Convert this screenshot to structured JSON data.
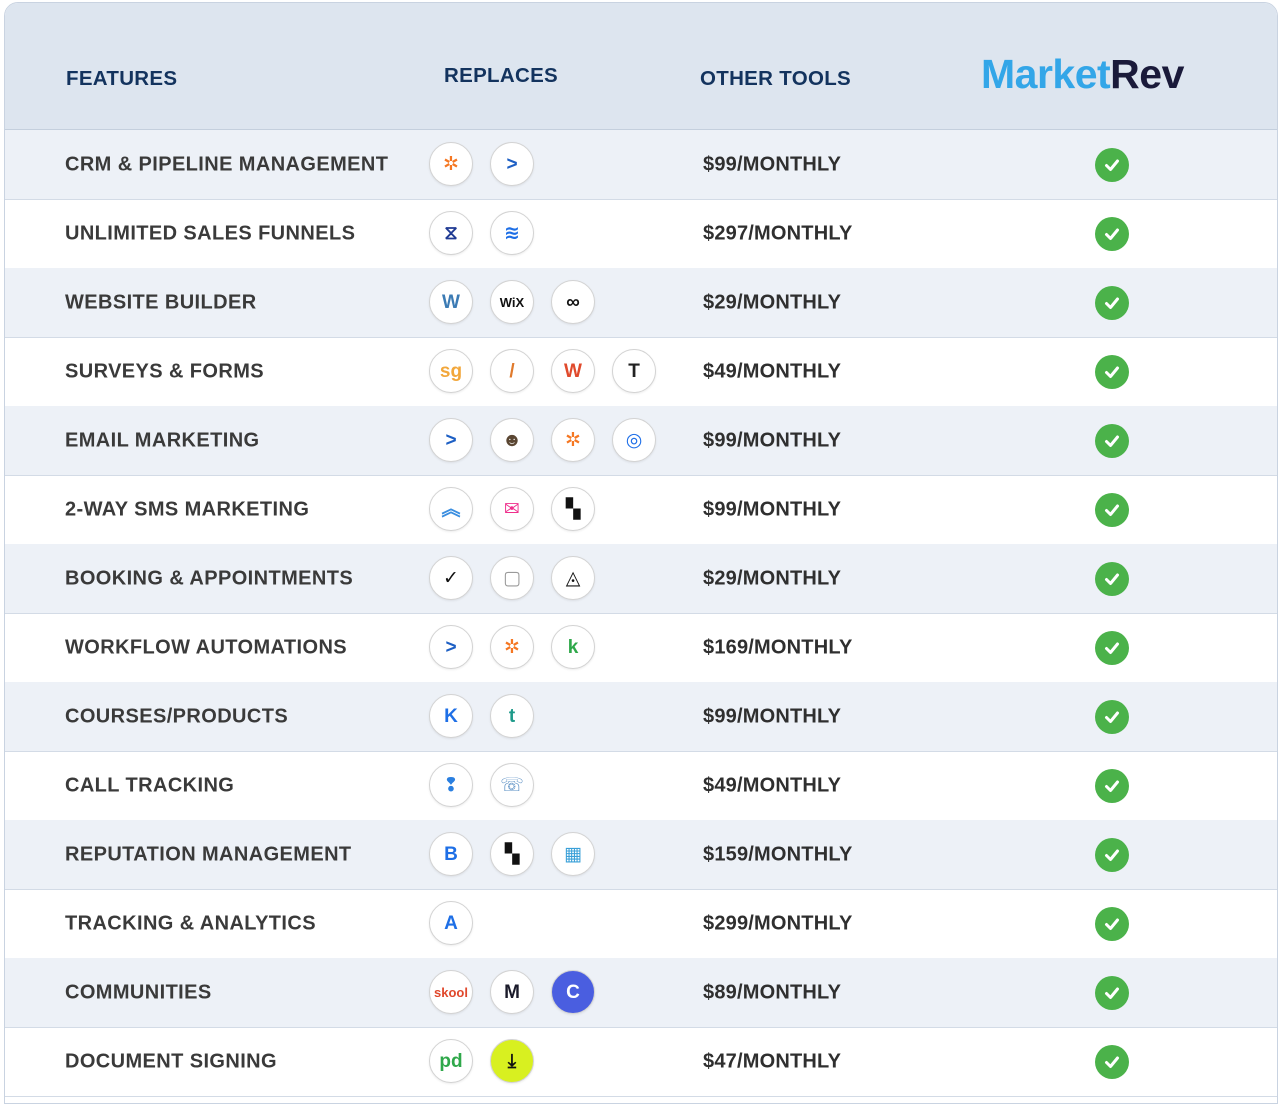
{
  "header": {
    "features": "FEATURES",
    "replaces": "REPLACES",
    "other_tools": "OTHER TOOLS",
    "logo_part1": "Market",
    "logo_part2": "Rev"
  },
  "colors": {
    "header_bg": "#dde5ef",
    "header_text": "#13335e",
    "logo_blue": "#33a6e8",
    "logo_dark": "#1a1a3a",
    "check_green": "#4bb24a",
    "alt_row": "#edf1f7"
  },
  "rows": [
    {
      "feature": "CRM & PIPELINE MANAGEMENT",
      "price": "$99/MONTHLY",
      "included": true,
      "icons": [
        {
          "name": "hubspot-icon",
          "glyph": "✲",
          "color": "#f57722"
        },
        {
          "name": "activecampaign-icon",
          "glyph": ">",
          "color": "#1d5fc4"
        }
      ]
    },
    {
      "feature": "UNLIMITED SALES FUNNELS",
      "price": "$297/MONTHLY",
      "included": true,
      "icons": [
        {
          "name": "clickfunnels-icon",
          "glyph": "⧖",
          "color": "#1f3a93"
        },
        {
          "name": "leadpages-icon",
          "glyph": "≋",
          "color": "#1e6fe6"
        }
      ]
    },
    {
      "feature": "WEBSITE BUILDER",
      "price": "$29/MONTHLY",
      "included": true,
      "icons": [
        {
          "name": "wordpress-icon",
          "glyph": "W",
          "color": "#3c7bb4"
        },
        {
          "name": "wix-icon",
          "glyph": "WiX",
          "color": "#111111"
        },
        {
          "name": "squarespace-icon",
          "glyph": "∞",
          "color": "#111111"
        }
      ]
    },
    {
      "feature": "SURVEYS & FORMS",
      "price": "$49/MONTHLY",
      "included": true,
      "icons": [
        {
          "name": "surveygizmo-icon",
          "glyph": "sg",
          "color": "#f2a73b"
        },
        {
          "name": "formstack-icon",
          "glyph": "/",
          "color": "#e07a2c"
        },
        {
          "name": "wufoo-icon",
          "glyph": "W",
          "color": "#e04a2c"
        },
        {
          "name": "typeform-icon",
          "glyph": "T",
          "color": "#222222"
        }
      ]
    },
    {
      "feature": "EMAIL MARKETING",
      "price": "$99/MONTHLY",
      "included": true,
      "icons": [
        {
          "name": "activecampaign-icon",
          "glyph": ">",
          "color": "#1d5fc4"
        },
        {
          "name": "mailchimp-icon",
          "glyph": "☻",
          "color": "#5a4632"
        },
        {
          "name": "hubspot-icon",
          "glyph": "✲",
          "color": "#f57722"
        },
        {
          "name": "constant-contact-icon",
          "glyph": "◎",
          "color": "#1d6ee8"
        }
      ]
    },
    {
      "feature": "2-WAY SMS MARKETING",
      "price": "$99/MONTHLY",
      "included": true,
      "icons": [
        {
          "name": "simpletexting-icon",
          "glyph": "︽",
          "color": "#3a8ee0"
        },
        {
          "name": "eztexting-icon",
          "glyph": "✉",
          "color": "#ef2f8c"
        },
        {
          "name": "podium-icon",
          "glyph": "▚",
          "color": "#111111"
        }
      ]
    },
    {
      "feature": "BOOKING & APPOINTMENTS",
      "price": "$29/MONTHLY",
      "included": true,
      "icons": [
        {
          "name": "calendly-icon",
          "glyph": "✓",
          "color": "#111111"
        },
        {
          "name": "calendar-icon",
          "glyph": "▢",
          "color": "#9a9a9a"
        },
        {
          "name": "acuity-icon",
          "glyph": "◬",
          "color": "#111111"
        }
      ]
    },
    {
      "feature": "WORKFLOW AUTOMATIONS",
      "price": "$169/MONTHLY",
      "included": true,
      "icons": [
        {
          "name": "activecampaign-icon",
          "glyph": ">",
          "color": "#1d5fc4"
        },
        {
          "name": "hubspot-icon",
          "glyph": "✲",
          "color": "#f57722"
        },
        {
          "name": "keap-icon",
          "glyph": "k",
          "color": "#2fa84a"
        }
      ]
    },
    {
      "feature": "COURSES/PRODUCTS",
      "price": "$99/MONTHLY",
      "included": true,
      "icons": [
        {
          "name": "kajabi-icon",
          "glyph": "K",
          "color": "#1e6fe6"
        },
        {
          "name": "teachable-icon",
          "glyph": "t",
          "color": "#1e9a8a"
        }
      ]
    },
    {
      "feature": "CALL TRACKING",
      "price": "$49/MONTHLY",
      "included": true,
      "icons": [
        {
          "name": "callrail-icon",
          "glyph": "❢",
          "color": "#2a7fe0"
        },
        {
          "name": "callrail-alt-icon",
          "glyph": "☏",
          "color": "#5a8fc4"
        }
      ]
    },
    {
      "feature": "REPUTATION MANAGEMENT",
      "price": "$159/MONTHLY",
      "included": true,
      "icons": [
        {
          "name": "birdeye-icon",
          "glyph": "B",
          "color": "#1e6fe6"
        },
        {
          "name": "podium-icon",
          "glyph": "▚",
          "color": "#111111"
        },
        {
          "name": "grade-us-icon",
          "glyph": "▦",
          "color": "#3aa0d8"
        }
      ]
    },
    {
      "feature": "TRACKING & ANALYTICS",
      "price": "$299/MONTHLY",
      "included": true,
      "icons": [
        {
          "name": "analytics-icon",
          "glyph": "A",
          "color": "#1e6fe6"
        }
      ]
    },
    {
      "feature": "COMMUNITIES",
      "price": "$89/MONTHLY",
      "included": true,
      "icons": [
        {
          "name": "skool-icon",
          "glyph": "skool",
          "color": "#e0482c"
        },
        {
          "name": "mighty-networks-icon",
          "glyph": "M",
          "color": "#1a1a2a"
        },
        {
          "name": "circle-icon",
          "glyph": "C",
          "color": "#ffffff",
          "bg": "#4a5ee0"
        }
      ]
    },
    {
      "feature": "DOCUMENT SIGNING",
      "price": "$47/MONTHLY",
      "included": true,
      "icons": [
        {
          "name": "pandadoc-icon",
          "glyph": "pd",
          "color": "#2fa84a"
        },
        {
          "name": "docusign-icon",
          "glyph": "⤓",
          "color": "#111111",
          "bg": "#d8f020"
        }
      ]
    }
  ]
}
